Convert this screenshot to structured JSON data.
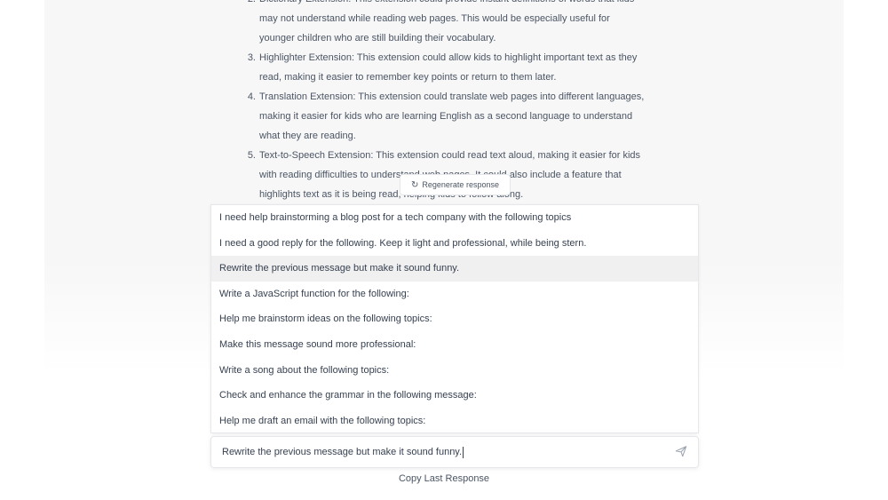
{
  "response": {
    "items": [
      {
        "num": "2.",
        "lines": [
          "Dictionary Extension: This extension could provide instant definitions of words that kids",
          "may not understand while reading web pages. This would be especially useful for",
          "younger children who are still building their vocabulary."
        ]
      },
      {
        "num": "3.",
        "lines": [
          "Highlighter Extension: This extension could allow kids to highlight important text as they",
          "read, making it easier to remember key points or return to them later."
        ]
      },
      {
        "num": "4.",
        "lines": [
          "Translation Extension: This extension could translate web pages into different languages,",
          "making it easier for kids who are learning English as a second language to understand",
          "what they are reading."
        ]
      },
      {
        "num": "5.",
        "lines": [
          "Text-to-Speech Extension: This extension could read text aloud, making it easier for kids",
          "with reading difficulties to understand web pages. It could also include a feature that",
          "highlights text as it is being read, helping kids to follow along."
        ]
      }
    ]
  },
  "regenerate": {
    "label": "Regenerate response",
    "icon": "refresh-icon"
  },
  "suggestions": [
    "I need help brainstorming a blog post for a tech company with the following topics",
    "I need a good reply for the following. Keep it light and professional, while being stern.",
    "Rewrite the previous message but make it sound funny.",
    "Write a JavaScript function for the following:",
    "Help me brainstorm ideas on the following topics:",
    "Make this message sound more professional:",
    "Write a song about the following topics:",
    "Check and enhance the grammar in the following message:",
    "Help me draft an email with the following topics:"
  ],
  "active_suggestion_index": 2,
  "input": {
    "value": "Rewrite the previous message but make it sound funny.",
    "send_icon": "send-icon"
  },
  "footer": {
    "copy_last": "Copy Last Response"
  }
}
